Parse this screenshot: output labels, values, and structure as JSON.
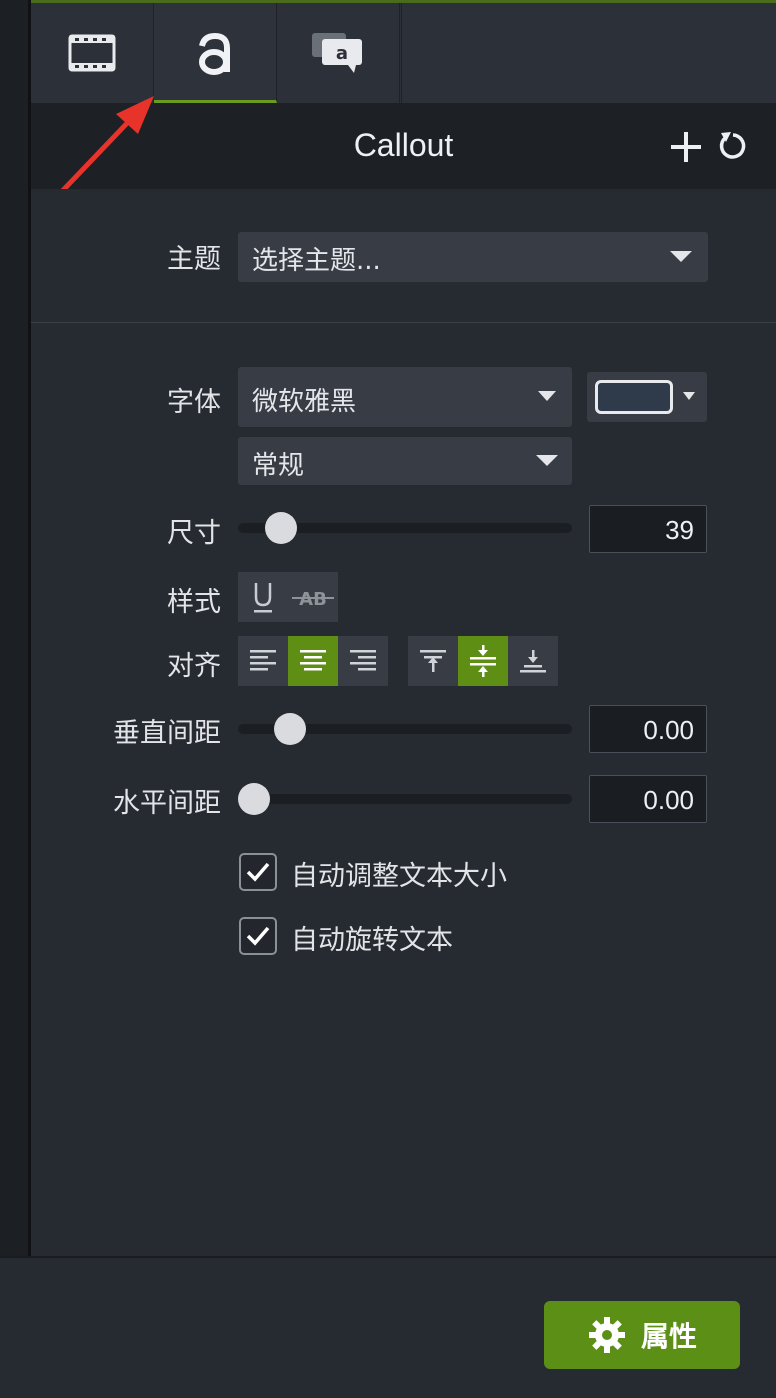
{
  "header": {
    "title": "Callout"
  },
  "theme": {
    "label": "主题",
    "value": "选择主题..."
  },
  "font": {
    "label": "字体",
    "family": "微软雅黑",
    "weight": "常规",
    "color": "#2f3a4a"
  },
  "size": {
    "label": "尺寸",
    "value": "39",
    "level": 0.09
  },
  "style": {
    "label": "样式"
  },
  "align": {
    "label": "对齐"
  },
  "vertical_spacing": {
    "label": "垂直间距",
    "value": "0.00",
    "level": 0.12
  },
  "horizontal_spacing": {
    "label": "水平间距",
    "value": "0.00",
    "level": 0.0
  },
  "checkboxes": [
    {
      "label": "自动调整文本大小",
      "checked": true
    },
    {
      "label": "自动旋转文本",
      "checked": true
    }
  ],
  "footer": {
    "properties_label": "属性"
  },
  "colors": {
    "accent": "#5e8f14",
    "annotation_arrow": "#e8332a"
  }
}
